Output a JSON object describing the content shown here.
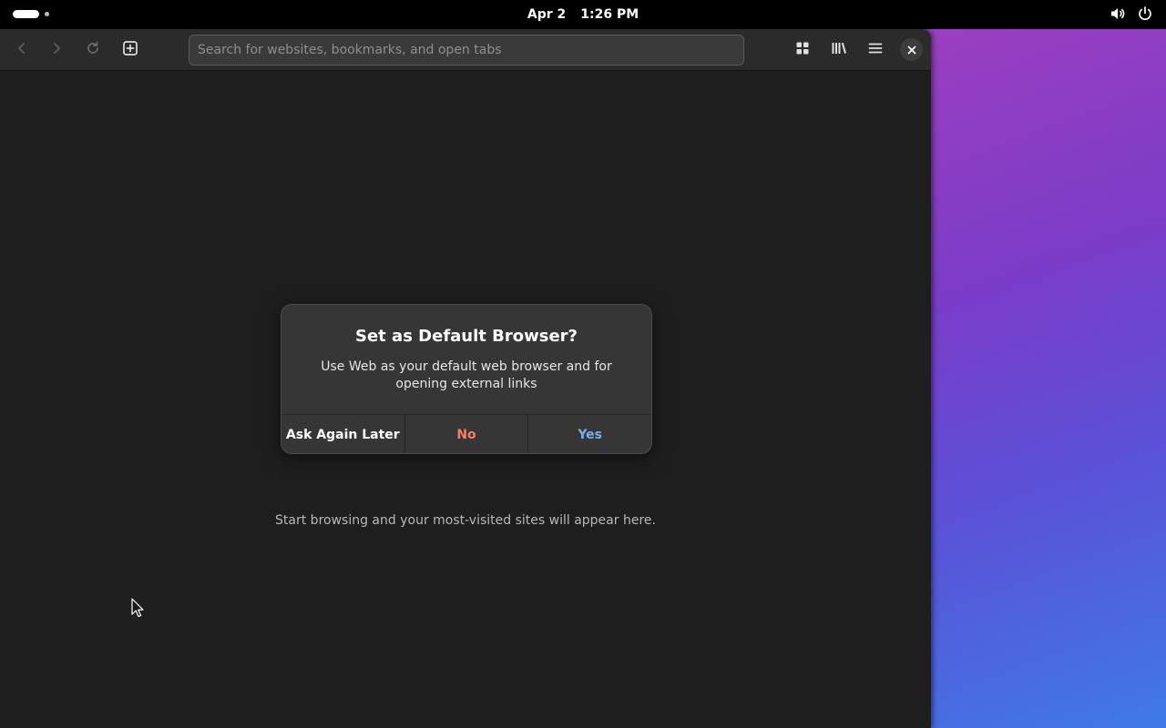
{
  "topbar": {
    "date": "Apr 2",
    "time": "1:26 PM",
    "volume_icon": "volume-icon",
    "power_icon": "power-icon"
  },
  "browser": {
    "url_placeholder": "Search for websites, bookmarks, and open tabs",
    "url_value": "",
    "empty_message": "Start browsing and your most-visited sites will appear here."
  },
  "dialog": {
    "title": "Set as Default Browser?",
    "body": "Use Web as your default web browser and for opening external links",
    "buttons": {
      "later": "Ask Again Later",
      "no": "No",
      "yes": "Yes"
    }
  },
  "colors": {
    "destructive": "#ff7b63",
    "accent": "#78aeed",
    "window_bg": "#1e1e1e",
    "headerbar_bg": "#2b2b2b"
  }
}
